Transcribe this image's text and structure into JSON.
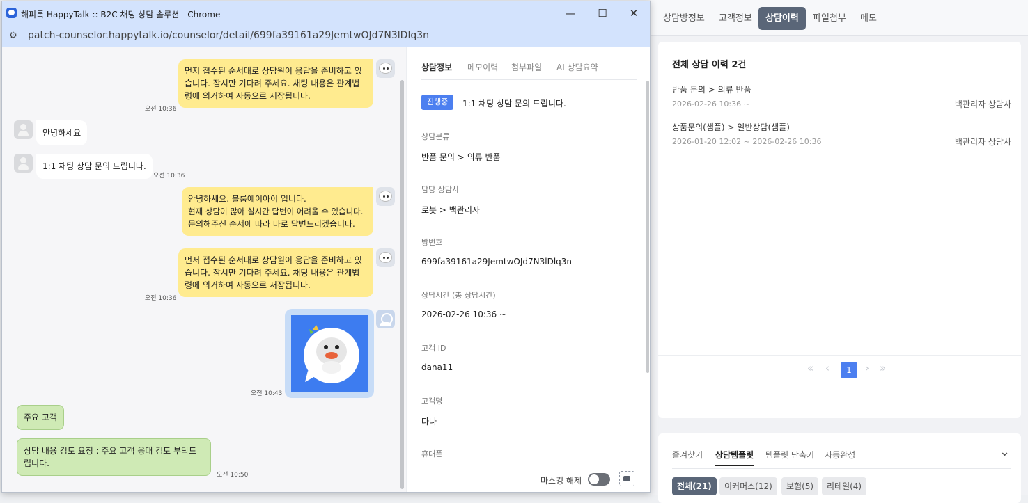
{
  "right": {
    "tabs": [
      "상담방정보",
      "고객정보",
      "상담이력",
      "파일첨부",
      "메모"
    ],
    "history_title": "전체 상담 이력 2건",
    "history": [
      {
        "category": "반품 문의  >  의류 반품",
        "date": "2026-02-26 10:36 ~",
        "agent": "백관리자 상담사"
      },
      {
        "category": "상품문의(샘플)  >  일반상담(샘플)",
        "date": "2026-01-20 12:02 ~ 2026-02-26 10:36",
        "agent": "백관리자 상담사"
      }
    ],
    "pager": {
      "first": "«",
      "prev": "‹",
      "page": "1",
      "next": "›",
      "last": "»"
    },
    "template_tabs": [
      "즐겨찾기",
      "상담템플릿",
      "템플릿 단축키",
      "자동완성"
    ],
    "template_collapse": "⌄",
    "chips": [
      "전체(21)",
      "이커머스(12)",
      "보험(5)",
      "리테일(4)"
    ]
  },
  "window": {
    "title": "해피톡 HappyTalk :: B2C 채팅 상담 솔루션 - Chrome",
    "url": "patch-counselor.happytalk.io/counselor/detail/699fa39161a29JemtwOJd7N3lDlq3n",
    "min": "—",
    "max": "☐",
    "close": "✕"
  },
  "chat": {
    "msg1": "먼저 접수된 순서대로 상담원이 응답을 준비하고 있습니다. 잠시만 기다려 주세요. 채팅 내용은 관계법령에 의거하여 자동으로 저장됩니다.",
    "msg1_time": "오전 10:36",
    "msg2": "안녕하세요",
    "msg3": "1:1 채팅 상담 문의 드립니다.",
    "msg3_time": "오전 10:36",
    "msg4_l1": "안녕하세요. 블룸에이아이 입니다.",
    "msg4_l2": "현재 상담이 많아 실시간 답변이 어려울 수 있습니다.",
    "msg4_l3": "문의해주신 순서에 따라 바로 답변드리겠습니다.",
    "msg5": "먼저 접수된 순서대로 상담원이 응답을 준비하고 있습니다. 잠시만 기다려 주세요. 채팅 내용은 관계법령에 의거하여 자동으로 저장됩니다.",
    "msg5_time": "오전 10:36",
    "img_time": "오전 10:43",
    "note1": "주요 고객",
    "note2": "상담 내용 검토 요청 : 주요 고객 응대 검토 부탁드립니다.",
    "note2_time": "오전 10:50"
  },
  "info": {
    "tabs": [
      "상담정보",
      "메모이력",
      "첨부파일",
      "AI 상담요약"
    ],
    "status": "진행중",
    "subject": "1:1 채팅 상담 문의 드립니다.",
    "category_label": "상담분류",
    "category_value": "반품 문의  >  의류 반품",
    "agent_label": "담당 상담사",
    "agent_value": "로봇  >  백관리자",
    "room_label": "방번호",
    "room_value": "699fa39161a29JemtwOJd7N3lDlq3n",
    "time_label": "상담시간 (총 상담시간)",
    "time_value": "2026-02-26 10:36 ~",
    "cid_label": "고객 ID",
    "cid_value": "dana11",
    "cname_label": "고객명",
    "cname_value": "다나",
    "phone_label": "휴대폰",
    "masking_label": "마스킹 해제"
  }
}
